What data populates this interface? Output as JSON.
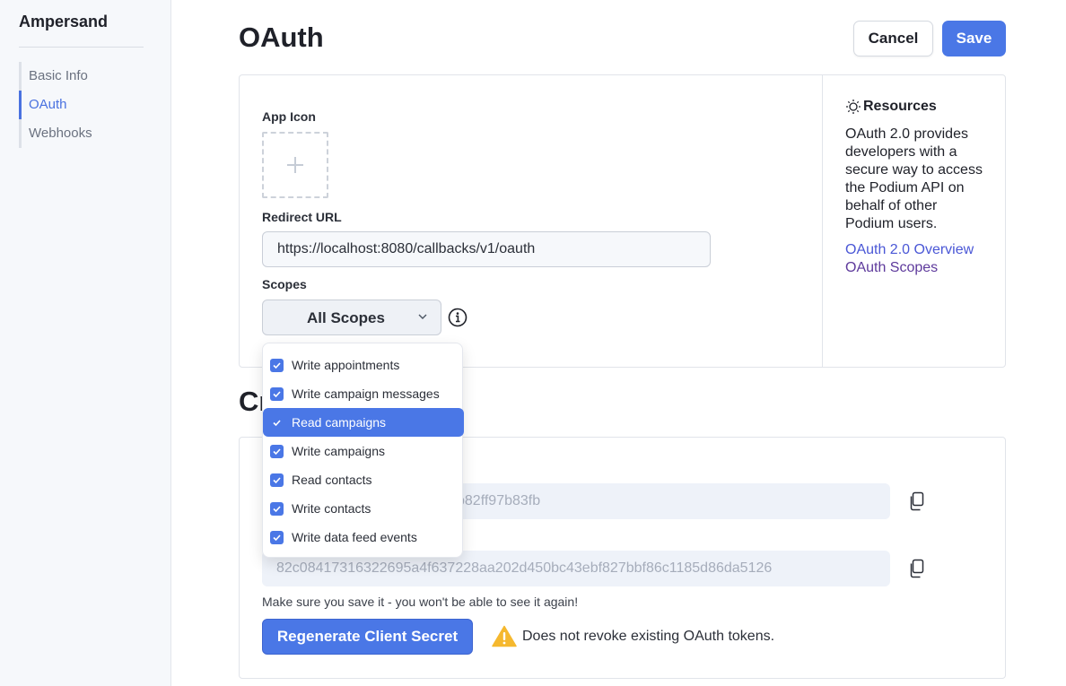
{
  "sidebar": {
    "brand": "Ampersand",
    "items": [
      {
        "label": "Basic Info",
        "active": false
      },
      {
        "label": "OAuth",
        "active": true
      },
      {
        "label": "Webhooks",
        "active": false
      }
    ]
  },
  "header": {
    "title": "OAuth",
    "cancel_label": "Cancel",
    "save_label": "Save"
  },
  "oauth_form": {
    "app_icon_label": "App Icon",
    "redirect_label": "Redirect URL",
    "redirect_value": "https://localhost:8080/callbacks/v1/oauth",
    "scopes_label": "Scopes",
    "scopes_selected": "All Scopes"
  },
  "resources": {
    "title": "Resources",
    "body": "OAuth 2.0 provides developers with a secure way to access the Podium API on behalf of other Podium users.",
    "links": [
      {
        "label": "OAuth 2.0 Overview",
        "color": "#4a57d6"
      },
      {
        "label": "OAuth Scopes",
        "color": "#5e3a9c"
      }
    ]
  },
  "credentials": {
    "section_title": "Cr",
    "client_id_value": "b82ff97b83fb",
    "client_secret_value": "82c08417316322695a4f637228aa202d450bc43ebf827bbf86c1185d86da5126",
    "hint": "Make sure you save it - you won't be able to see it again!",
    "regenerate_label": "Regenerate Client Secret",
    "warning": "Does not revoke existing OAuth tokens."
  },
  "scopes_dropdown": {
    "options": [
      {
        "label": "Write appointments",
        "checked": true,
        "highlighted": false
      },
      {
        "label": "Write campaign messages",
        "checked": true,
        "highlighted": false
      },
      {
        "label": "Read campaigns",
        "checked": true,
        "highlighted": true
      },
      {
        "label": "Write campaigns",
        "checked": true,
        "highlighted": false
      },
      {
        "label": "Read contacts",
        "checked": true,
        "highlighted": false
      },
      {
        "label": "Write contacts",
        "checked": true,
        "highlighted": false
      },
      {
        "label": "Write data feed events",
        "checked": true,
        "highlighted": false
      }
    ]
  },
  "colors": {
    "accent": "#4a77e6",
    "warning": "#f5b82e"
  }
}
